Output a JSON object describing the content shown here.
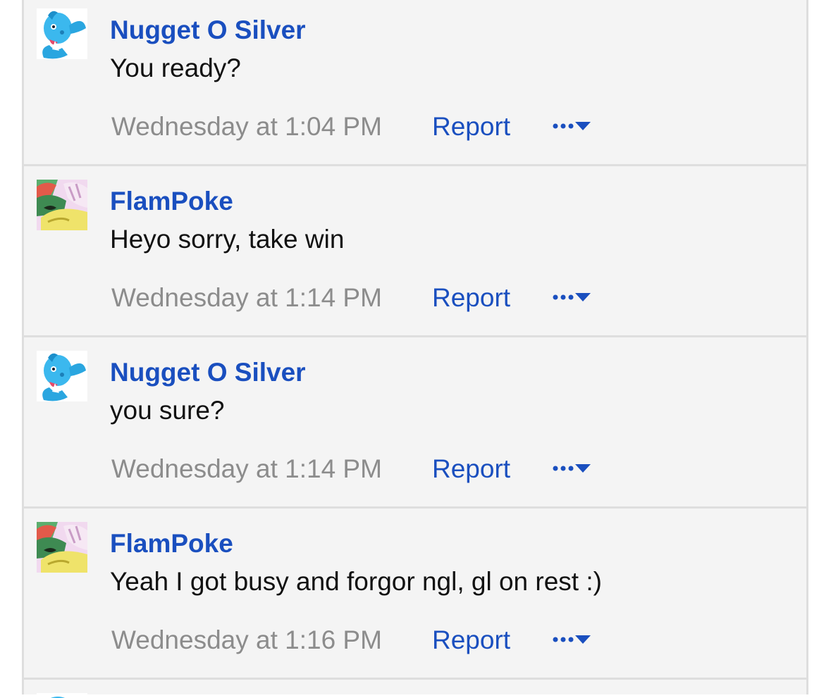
{
  "posts": [
    {
      "username": "Nugget O Silver",
      "message": "You ready?",
      "timestamp": "Wednesday at 1:04 PM",
      "report_label": "Report",
      "avatar_icon": "blue-pokemon-avatar-icon"
    },
    {
      "username": "FlamPoke",
      "message": "Heyo sorry, take win",
      "timestamp": "Wednesday at 1:14 PM",
      "report_label": "Report",
      "avatar_icon": "colorful-pokemon-avatar-icon"
    },
    {
      "username": "Nugget O Silver",
      "message": "you sure?",
      "timestamp": "Wednesday at 1:14 PM",
      "report_label": "Report",
      "avatar_icon": "blue-pokemon-avatar-icon"
    },
    {
      "username": "FlamPoke",
      "message": "Yeah I got busy and forgor ngl, gl on rest :)",
      "timestamp": "Wednesday at 1:16 PM",
      "report_label": "Report",
      "avatar_icon": "colorful-pokemon-avatar-icon"
    }
  ],
  "colors": {
    "link": "#1a4fbf",
    "muted": "#8c8c8c",
    "background": "#f4f4f4",
    "border": "#dedede"
  }
}
